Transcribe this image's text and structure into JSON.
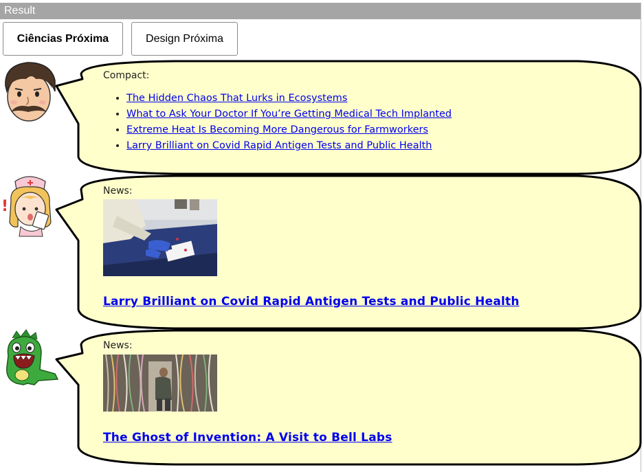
{
  "window": {
    "title": "Result"
  },
  "buttons": {
    "ciencias": "Ciências Próxima",
    "design": "Design Próxima"
  },
  "bubbles": {
    "compact": {
      "label": "Compact:",
      "items": [
        "The Hidden Chaos That Lurks in Ecosystems",
        "What to Ask Your Doctor If You’re Getting Medical Tech Implanted",
        "Extreme Heat Is Becoming More Dangerous for Farmworkers",
        "Larry Brilliant on Covid Rapid Antigen Tests and Public Health"
      ]
    },
    "news1": {
      "label": "News:",
      "title": "Larry Brilliant on Covid Rapid Antigen Tests and Public Health"
    },
    "news2": {
      "label": "News:",
      "title": "The Ghost of Invention: A Visit to Bell Labs"
    }
  },
  "colors": {
    "bubble_fill": "#ffffcc",
    "link": "#0000ee",
    "titlebar": "#a5a5a5"
  }
}
